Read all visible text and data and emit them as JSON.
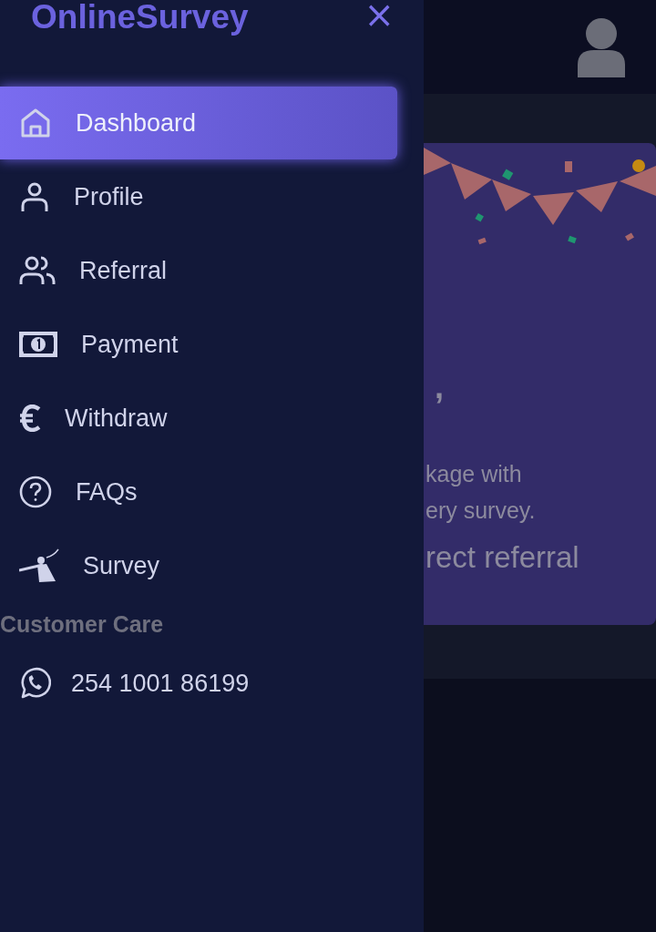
{
  "sidebar": {
    "brand": "OnlineSurvey",
    "close": "×",
    "items": [
      {
        "label": "Dashboard",
        "kind": "home",
        "selected": true
      },
      {
        "label": "Profile",
        "kind": "person",
        "selected": false
      },
      {
        "label": "Referral",
        "kind": "people",
        "selected": false
      },
      {
        "label": "Payment",
        "kind": "banknote",
        "selected": false
      },
      {
        "label": "Withdraw",
        "kind": "euro",
        "selected": false
      },
      {
        "label": "FAQs",
        "kind": "question",
        "selected": false
      },
      {
        "label": "Survey",
        "kind": "figure",
        "selected": false
      }
    ],
    "section_title": "Customer Care",
    "contact": {
      "label": "254 1001 86199",
      "kind": "chat"
    }
  },
  "background": {
    "card_lines": [
      ",",
      "kage with",
      "ery survey.",
      "rect referral"
    ]
  }
}
